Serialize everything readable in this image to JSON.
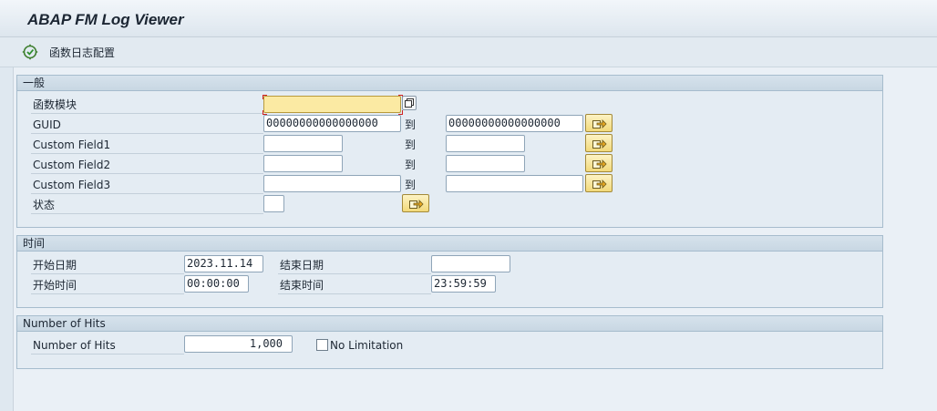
{
  "window": {
    "title": "ABAP FM Log Viewer"
  },
  "toolbar": {
    "config_label": "函数日志配置",
    "config_icon": "execute-config-icon"
  },
  "general": {
    "header": "一般",
    "to_label": "到",
    "function_module": {
      "label": "函数模块",
      "value": ""
    },
    "guid": {
      "label": "GUID",
      "from": "00000000000000000",
      "to": "00000000000000000"
    },
    "custom1": {
      "label": "Custom Field1",
      "from": "",
      "to": ""
    },
    "custom2": {
      "label": "Custom Field2",
      "from": "",
      "to": ""
    },
    "custom3": {
      "label": "Custom Field3",
      "from": "",
      "to": ""
    },
    "status": {
      "label": "状态",
      "value": ""
    }
  },
  "time": {
    "header": "时间",
    "start_date": {
      "label": "开始日期",
      "value": "2023.11.14"
    },
    "end_date": {
      "label": "结束日期",
      "value": ""
    },
    "start_time": {
      "label": "开始时间",
      "value": "00:00:00"
    },
    "end_time": {
      "label": "结束时间",
      "value": "23:59:59"
    }
  },
  "hits": {
    "header": "Number of Hits",
    "label": "Number of Hits",
    "value": "1,000",
    "no_limit_label": "No Limitation",
    "no_limit_checked": false
  },
  "colors": {
    "required_field": "#fbeaa3",
    "select_button": "#f2d97a",
    "group_border": "#a6bccd"
  }
}
